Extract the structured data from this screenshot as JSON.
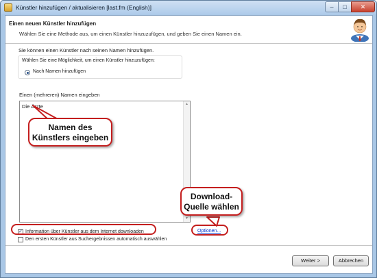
{
  "window": {
    "title": "Künstler hinzufügen / aktualisieren [last.fm (English)]",
    "controls": {
      "minimize": "–",
      "maximize": "□",
      "close": "✕"
    }
  },
  "header": {
    "title": "Einen neuen Künstler hinzufügen",
    "subtitle": "Wählen Sie eine Methode aus, um einen Künstler hinzuzufügen, und geben Sie einen Namen ein."
  },
  "main": {
    "intro": "Sie können einen Künstler nach seinen Namen hinzufügen.",
    "method_group_label": "Wählen Sie eine Möglichkeit, um einen Künstler hinzuzufügen:",
    "method_option": "Nach Namen hinzufügen",
    "names_label": "Einen (mehreren) Namen eingeben",
    "names_value": "Die Ärzte",
    "checkbox_download": {
      "label": "Information über Künstler aus dem Internet downloaden",
      "checked": true,
      "mark": "✓"
    },
    "checkbox_auto_select": {
      "label": "Den ersten Künstler aus Suchergebnissen automatisch auswählen",
      "checked": false,
      "mark": ""
    },
    "options_link": "Optionen...",
    "scroll_up": "▲",
    "scroll_down": "▼"
  },
  "footer": {
    "next_label": "Weiter >",
    "cancel_label": "Abbrechen"
  },
  "annotations": {
    "names_callout": "Namen des Künstlers eingeben",
    "names_callout_line1": "Namen des",
    "names_callout_line2": "Künstlers eingeben",
    "download_callout_line1": "Download-",
    "download_callout_line2": "Quelle wählen"
  },
  "colors": {
    "annotation_red": "#c41e1e",
    "link_blue": "#0033cc",
    "window_frame": "#a9c7e6"
  }
}
